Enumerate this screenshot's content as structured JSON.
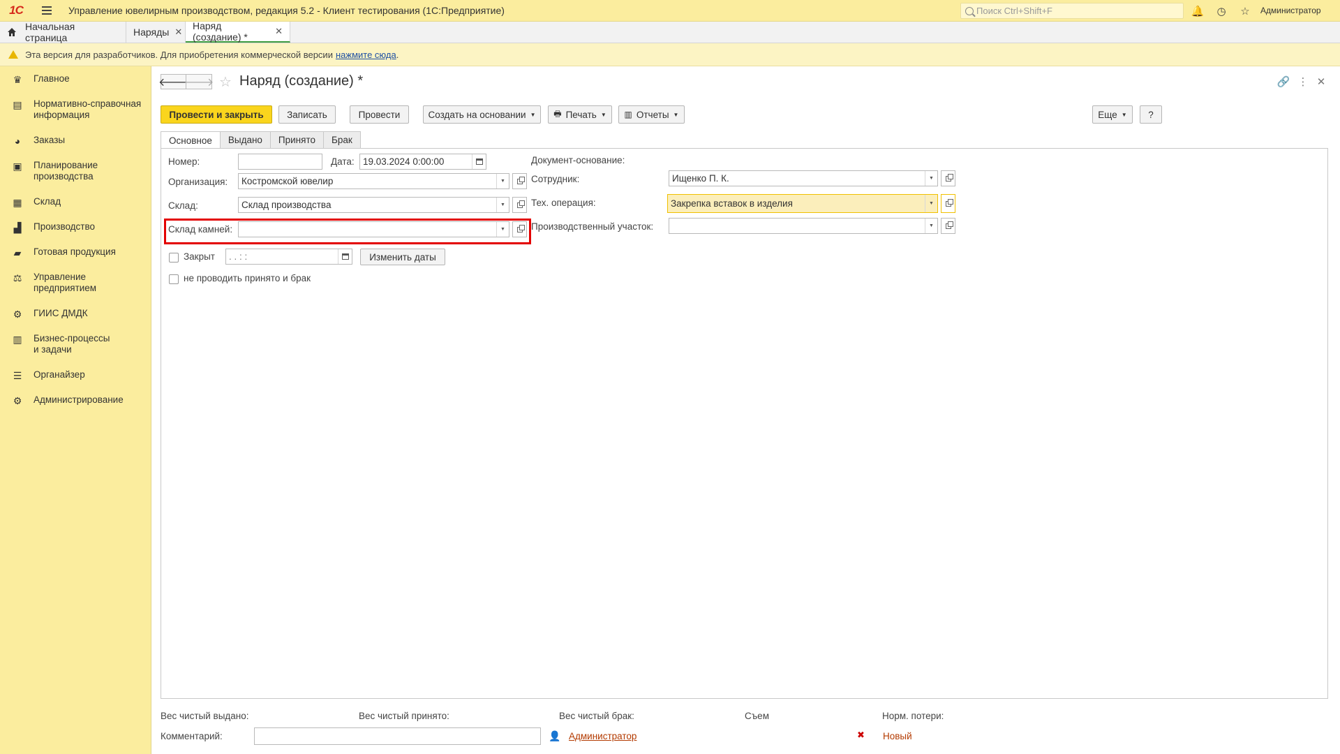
{
  "window": {
    "app_title": "Управление ювелирным производством, редакция 5.2  - Клиент тестирования (1С:Предприятие)",
    "search_placeholder": "Поиск Ctrl+Shift+F",
    "user": "Администратор"
  },
  "open_tabs": [
    {
      "label": "Начальная страница"
    },
    {
      "label": "Наряды"
    },
    {
      "label": "Наряд (создание) *"
    }
  ],
  "banner": {
    "text": "Эта версия для разработчиков. Для приобретения коммерческой версии",
    "link": "нажмите сюда",
    "tail": "."
  },
  "sidebar": {
    "items": [
      {
        "label": "Главное",
        "icon": "crown-icon"
      },
      {
        "label": "Нормативно-справочная\nинформация",
        "icon": "books-icon"
      },
      {
        "label": "Заказы",
        "icon": "pie-chart-icon"
      },
      {
        "label": "Планирование\nпроизводства",
        "icon": "clipboard-icon"
      },
      {
        "label": "Склад",
        "icon": "grid-icon"
      },
      {
        "label": "Производство",
        "icon": "factory-icon"
      },
      {
        "label": "Готовая продукция",
        "icon": "bag-icon"
      },
      {
        "label": "Управление\nпредприятием",
        "icon": "enterprise-icon"
      },
      {
        "label": "ГИИС ДМДК",
        "icon": "gear-link-icon"
      },
      {
        "label": "Бизнес-процессы\nи задачи",
        "icon": "tasks-icon"
      },
      {
        "label": "Органайзер",
        "icon": "organizer-icon"
      },
      {
        "label": "Администрирование",
        "icon": "gear-icon"
      }
    ]
  },
  "document": {
    "title": "Наряд (создание) *"
  },
  "toolbar": {
    "post_close": "Провести и закрыть",
    "save": "Записать",
    "post": "Провести",
    "create_based": "Создать на основании",
    "print": "Печать",
    "reports": "Отчеты",
    "more": "Еще",
    "help": "?"
  },
  "form_tabs": [
    {
      "label": "Основное"
    },
    {
      "label": "Выдано"
    },
    {
      "label": "Принято"
    },
    {
      "label": "Брак"
    }
  ],
  "form": {
    "number_label": "Номер:",
    "number_value": "",
    "date_label": "Дата:",
    "date_value": "19.03.2024  0:00:00",
    "org_label": "Организация:",
    "org_value": "Костромской ювелир",
    "warehouse_label": "Склад:",
    "warehouse_value": "Склад производства",
    "stone_warehouse_label": "Склад камней:",
    "stone_warehouse_value": "",
    "closed_label": "Закрыт",
    "closed_date_value": " .  .       :  :",
    "change_dates": "Изменить даты",
    "no_post_label": "не проводить принято и брак",
    "basis_label": "Документ-основание:",
    "employee_label": "Сотрудник:",
    "employee_value": "Ищенко П. К.",
    "tech_op_label": "Тех. операция:",
    "tech_op_value": "Закрепка вставок в изделия",
    "area_label": "Производственный участок:",
    "area_value": ""
  },
  "footer": {
    "net_issued": "Вес чистый выдано:",
    "net_received": "Вес чистый принято:",
    "net_defect": "Вес чистый брак:",
    "removal": "Съем",
    "norm_loss": "Норм. потери:",
    "comment_label": "Комментарий:",
    "comment_value": "",
    "author": "Администратор",
    "status": "Новый"
  }
}
